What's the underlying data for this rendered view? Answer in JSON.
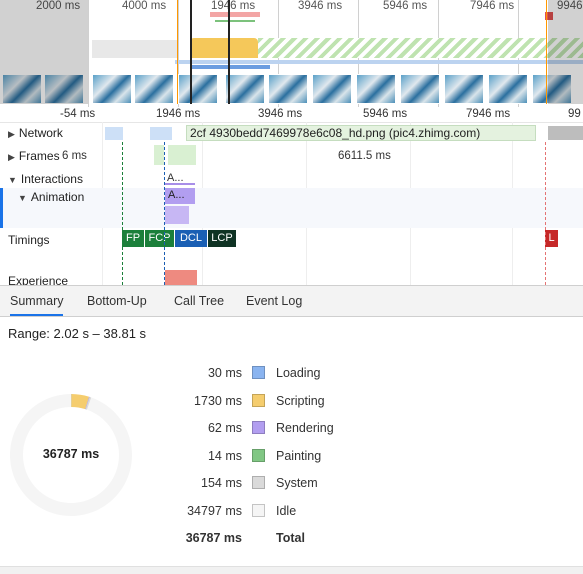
{
  "overview": {
    "ticks": [
      "2000 ms",
      "4000 ms",
      "1946 ms",
      "3946 ms",
      "5946 ms",
      "7946 ms",
      "9946"
    ]
  },
  "ruler": {
    "ticks": [
      "-54 ms",
      "1946 ms",
      "3946 ms",
      "5946 ms",
      "7946 ms",
      "99"
    ]
  },
  "tracks": {
    "network_label": "Network",
    "network_request": "2cf 4930bedd7469978e6c08_hd.png (pic4.zhimg.com)",
    "frames_label": "Frames",
    "frames_first": "6 ms",
    "frames_long": "6611.5 ms",
    "interactions_label": "Interactions",
    "interaction_event": "A...",
    "animation_label": "Animation",
    "animation_event": "A...",
    "timings_label": "Timings",
    "experience_label": "Experience",
    "timings": {
      "fp": "FP",
      "fcp": "FCP",
      "dcl": "DCL",
      "lcp": "LCP",
      "load": "L"
    }
  },
  "tabs": [
    "Summary",
    "Bottom-Up",
    "Call Tree",
    "Event Log"
  ],
  "summary": {
    "range": "Range: 2.02 s – 38.81 s",
    "total_center": "36787 ms",
    "rows": [
      {
        "value": "30 ms",
        "label": "Loading",
        "ms": 30,
        "color": "#8ab4f0"
      },
      {
        "value": "1730 ms",
        "label": "Scripting",
        "ms": 1730,
        "color": "#f5cd6e"
      },
      {
        "value": "62 ms",
        "label": "Rendering",
        "ms": 62,
        "color": "#b29ef0"
      },
      {
        "value": "14 ms",
        "label": "Painting",
        "ms": 14,
        "color": "#81c784"
      },
      {
        "value": "154 ms",
        "label": "System",
        "ms": 154,
        "color": "#dadada"
      },
      {
        "value": "34797 ms",
        "label": "Idle",
        "ms": 34797,
        "color": "#f5f5f5"
      }
    ],
    "total_value": "36787 ms",
    "total_label": "Total"
  }
}
